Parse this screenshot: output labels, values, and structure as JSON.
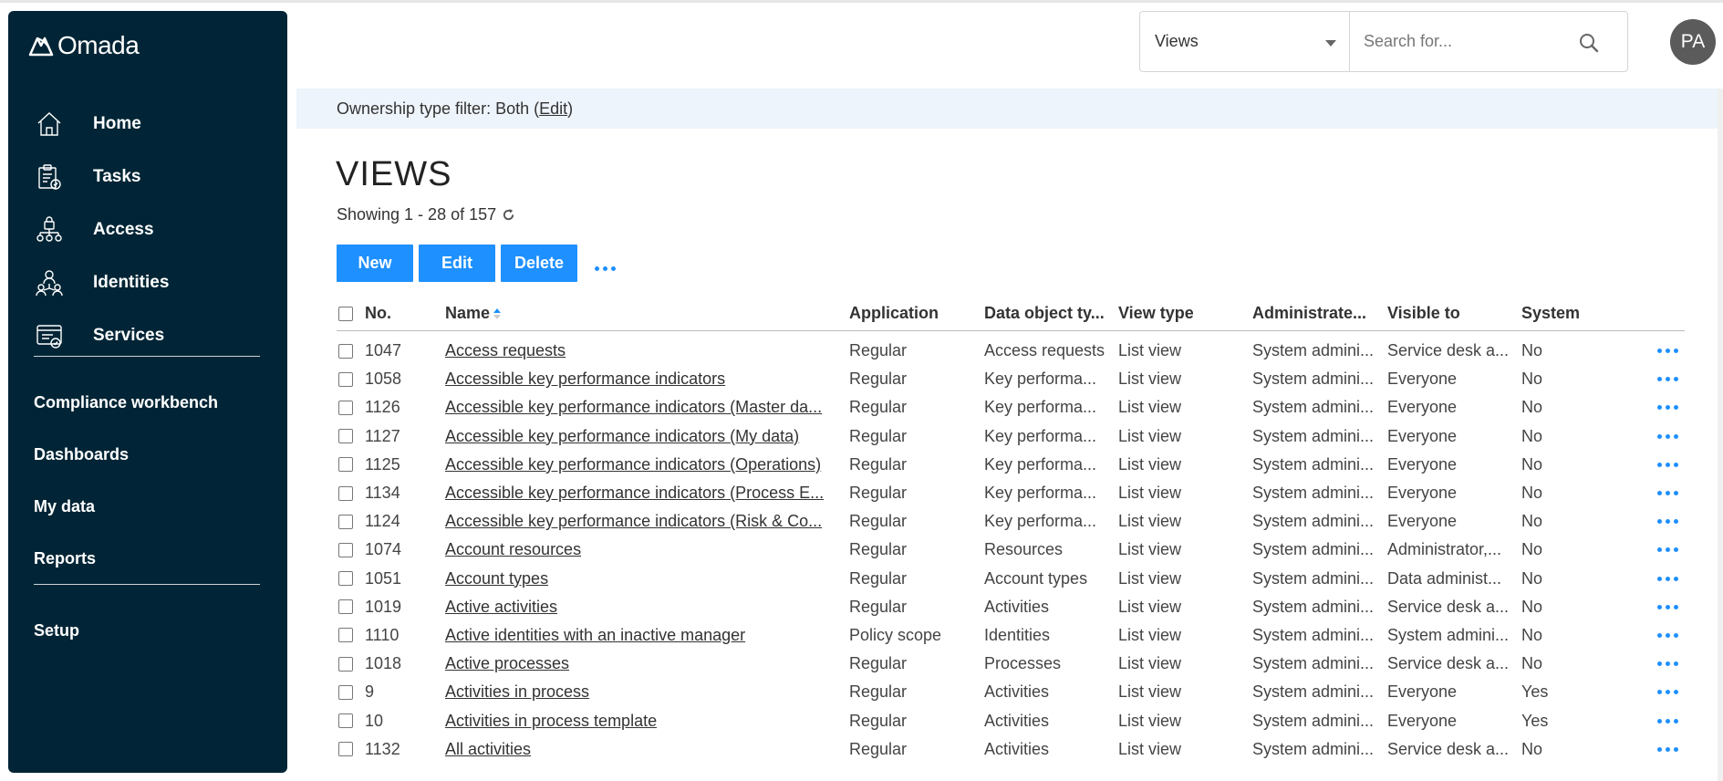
{
  "app": {
    "logo_text": "Omada"
  },
  "sidebar": {
    "main_items": [
      {
        "label": "Home",
        "icon": "home-icon"
      },
      {
        "label": "Tasks",
        "icon": "tasks-icon"
      },
      {
        "label": "Access",
        "icon": "access-icon"
      },
      {
        "label": "Identities",
        "icon": "identities-icon"
      },
      {
        "label": "Services",
        "icon": "services-icon"
      }
    ],
    "secondary_items": [
      {
        "label": "Compliance workbench"
      },
      {
        "label": "Dashboards"
      },
      {
        "label": "My data"
      },
      {
        "label": "Reports"
      }
    ],
    "setup_label": "Setup"
  },
  "header": {
    "views_select": "Views",
    "search_placeholder": "Search for...",
    "avatar_initials": "PA"
  },
  "filter": {
    "prefix": "Ownership type filter: Both (",
    "edit_label": "Edit",
    "suffix": ")"
  },
  "page": {
    "title": "VIEWS",
    "showing": "Showing 1 - 28 of 157",
    "buttons": {
      "new": "New",
      "edit": "Edit",
      "delete": "Delete"
    }
  },
  "table": {
    "columns": [
      "No.",
      "Name",
      "Application",
      "Data object ty...",
      "View type",
      "Administrate...",
      "Visible to",
      "System"
    ],
    "rows": [
      [
        "1047",
        "Access requests",
        "Regular",
        "Access requests",
        "List view",
        "System admini...",
        "Service desk a...",
        "No"
      ],
      [
        "1058",
        "Accessible key performance indicators",
        "Regular",
        "Key performa...",
        "List view",
        "System admini...",
        "Everyone",
        "No"
      ],
      [
        "1126",
        "Accessible key performance indicators (Master da...",
        "Regular",
        "Key performa...",
        "List view",
        "System admini...",
        "Everyone",
        "No"
      ],
      [
        "1127",
        "Accessible key performance indicators (My data)",
        "Regular",
        "Key performa...",
        "List view",
        "System admini...",
        "Everyone",
        "No"
      ],
      [
        "1125",
        "Accessible key performance indicators (Operations)",
        "Regular",
        "Key performa...",
        "List view",
        "System admini...",
        "Everyone",
        "No"
      ],
      [
        "1134",
        "Accessible key performance indicators (Process E...",
        "Regular",
        "Key performa...",
        "List view",
        "System admini...",
        "Everyone",
        "No"
      ],
      [
        "1124",
        "Accessible key performance indicators (Risk & Co...",
        "Regular",
        "Key performa...",
        "List view",
        "System admini...",
        "Everyone",
        "No"
      ],
      [
        "1074",
        "Account resources",
        "Regular",
        "Resources",
        "List view",
        "System admini...",
        "Administrator,...",
        "No"
      ],
      [
        "1051",
        "Account types",
        "Regular",
        "Account types",
        "List view",
        "System admini...",
        "Data administ...",
        "No"
      ],
      [
        "1019",
        "Active activities",
        "Regular",
        "Activities",
        "List view",
        "System admini...",
        "Service desk a...",
        "No"
      ],
      [
        "1110",
        "Active identities with an inactive manager",
        "Policy scope",
        "Identities",
        "List view",
        "System admini...",
        "System admini...",
        "No"
      ],
      [
        "1018",
        "Active processes",
        "Regular",
        "Processes",
        "List view",
        "System admini...",
        "Service desk a...",
        "No"
      ],
      [
        "9",
        "Activities in process",
        "Regular",
        "Activities",
        "List view",
        "System admini...",
        "Everyone",
        "Yes"
      ],
      [
        "10",
        "Activities in process template",
        "Regular",
        "Activities",
        "List view",
        "System admini...",
        "Everyone",
        "Yes"
      ],
      [
        "1132",
        "All activities",
        "Regular",
        "Activities",
        "List view",
        "System admini...",
        "Service desk a...",
        "No"
      ]
    ]
  }
}
